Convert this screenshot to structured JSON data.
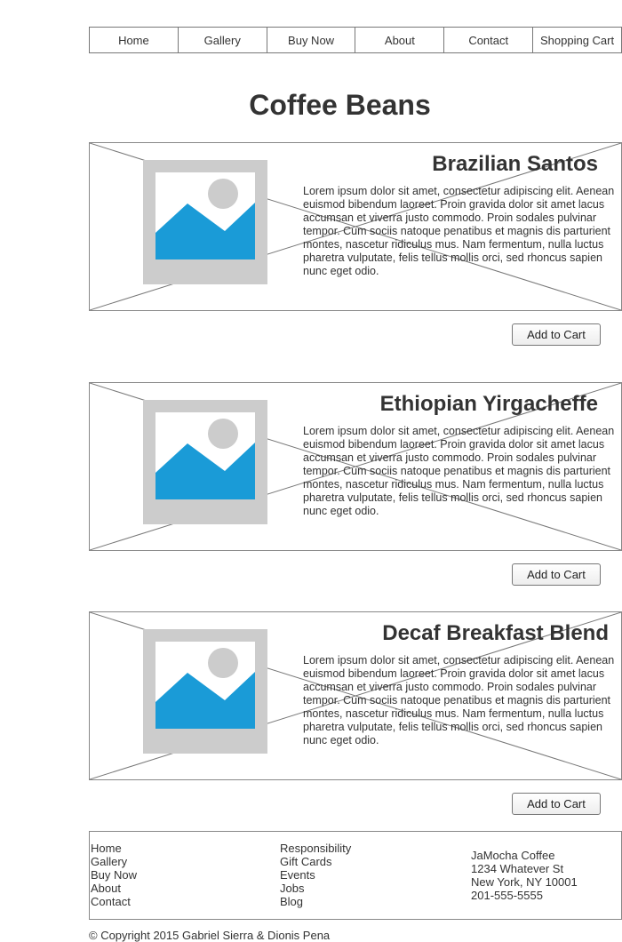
{
  "nav": {
    "items": [
      {
        "label": "Home"
      },
      {
        "label": "Gallery"
      },
      {
        "label": "Buy Now"
      },
      {
        "label": "About"
      },
      {
        "label": "Contact"
      },
      {
        "label": "Shopping Cart"
      }
    ]
  },
  "page": {
    "title": "Coffee Beans"
  },
  "products": [
    {
      "name": "Brazilian Santos",
      "description": "Lorem ipsum dolor sit amet, consectetur adipiscing elit. Aenean euismod bibendum laoreet. Proin gravida dolor sit amet lacus accumsan et viverra justo commodo. Proin sodales pulvinar tempor. Cum sociis natoque penatibus et magnis dis parturient montes, nascetur ridiculus mus. Nam fermentum, nulla luctus pharetra vulputate, felis tellus mollis orci, sed rhoncus sapien nunc eget odio.",
      "button": "Add to Cart"
    },
    {
      "name": "Ethiopian Yirgacheffe",
      "description": "Lorem ipsum dolor sit amet, consectetur adipiscing elit. Aenean euismod bibendum laoreet. Proin gravida dolor sit amet lacus accumsan et viverra justo commodo. Proin sodales pulvinar tempor. Cum sociis natoque penatibus et magnis dis parturient montes, nascetur ridiculus mus. Nam fermentum, nulla luctus pharetra vulputate, felis tellus mollis orci, sed rhoncus sapien nunc eget odio.",
      "button": "Add to Cart"
    },
    {
      "name": "Decaf Breakfast Blend",
      "description": "Lorem ipsum dolor sit amet, consectetur adipiscing elit. Aenean euismod bibendum laoreet. Proin gravida dolor sit amet lacus accumsan et viverra justo commodo. Proin sodales pulvinar tempor. Cum sociis natoque penatibus et magnis dis parturient montes, nascetur ridiculus mus. Nam fermentum, nulla luctus pharetra vulputate, felis tellus mollis orci, sed rhoncus sapien nunc eget odio.",
      "button": "Add to Cart"
    }
  ],
  "footer": {
    "nav_links": [
      "Home",
      "Gallery",
      "Buy Now",
      "About",
      "Contact"
    ],
    "info_links": [
      "Responsibility",
      "Gift Cards",
      "Events",
      "Jobs",
      "Blog"
    ],
    "address": [
      "JaMocha Coffee",
      "1234 Whatever St",
      "New York, NY 10001",
      "201-555-5555"
    ],
    "copyright": "© Copyright 2015 Gabriel Sierra & Dionis Pena"
  },
  "colors": {
    "image_placeholder_frame": "#cccccc",
    "image_placeholder_mountain": "#1a9bd7",
    "image_placeholder_sun": "#cccccc",
    "border": "#888888"
  }
}
